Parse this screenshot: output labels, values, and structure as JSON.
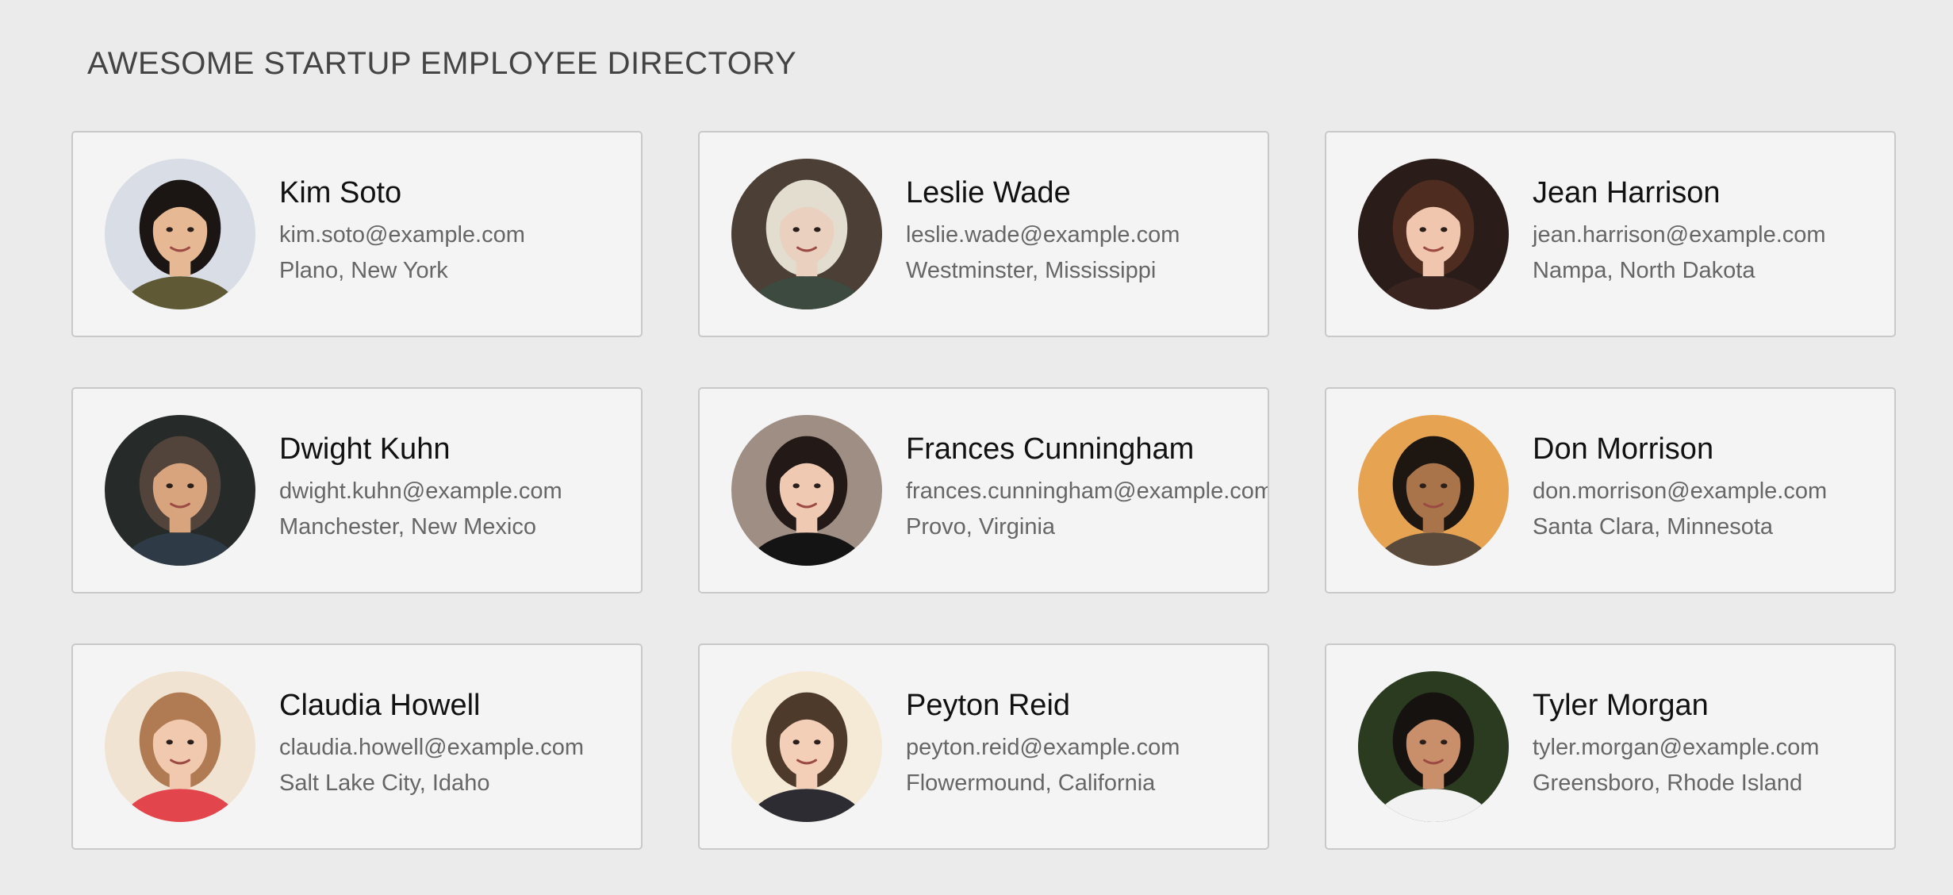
{
  "header": {
    "title": "AWESOME STARTUP EMPLOYEE DIRECTORY"
  },
  "employees": [
    {
      "name": "Kim Soto",
      "email": "kim.soto@example.com",
      "location": "Plano, New York",
      "avatar": {
        "bg": "#d8dde6",
        "hair": "#1b1613",
        "skin": "#e6b894",
        "shirt": "#5f5a35"
      }
    },
    {
      "name": "Leslie Wade",
      "email": "leslie.wade@example.com",
      "location": "Westminster, Mississippi",
      "avatar": {
        "bg": "#4b3f36",
        "hair": "#e3ddd0",
        "skin": "#ead0bf",
        "shirt": "#3d4a40"
      }
    },
    {
      "name": "Jean Harrison",
      "email": "jean.harrison@example.com",
      "location": "Nampa, North Dakota",
      "avatar": {
        "bg": "#2a1c18",
        "hair": "#4e2c20",
        "skin": "#f0c6ae",
        "shirt": "#3a2420"
      }
    },
    {
      "name": "Dwight Kuhn",
      "email": "dwight.kuhn@example.com",
      "location": "Manchester, New Mexico",
      "avatar": {
        "bg": "#262a28",
        "hair": "#52443a",
        "skin": "#d8a47e",
        "shirt": "#2e3b46"
      }
    },
    {
      "name": "Frances Cunningham",
      "email": "frances.cunningham@example.com",
      "location": "Provo, Virginia",
      "avatar": {
        "bg": "#9f8e83",
        "hair": "#231916",
        "skin": "#efc9b2",
        "shirt": "#141414"
      }
    },
    {
      "name": "Don Morrison",
      "email": "don.morrison@example.com",
      "location": "Santa Clara, Minnesota",
      "avatar": {
        "bg": "#e6a452",
        "hair": "#1d1611",
        "skin": "#a97449",
        "shirt": "#5a4a3c"
      }
    },
    {
      "name": "Claudia Howell",
      "email": "claudia.howell@example.com",
      "location": "Salt Lake City, Idaho",
      "avatar": {
        "bg": "#f1e3d2",
        "hair": "#b07b52",
        "skin": "#f0c9ae",
        "shirt": "#e2464c"
      }
    },
    {
      "name": "Peyton Reid",
      "email": "peyton.reid@example.com",
      "location": "Flowermound, California",
      "avatar": {
        "bg": "#f4ead6",
        "hair": "#4e3a2b",
        "skin": "#f4cfb8",
        "shirt": "#2c2c32"
      }
    },
    {
      "name": "Tyler Morgan",
      "email": "tyler.morgan@example.com",
      "location": "Greensboro, Rhode Island",
      "avatar": {
        "bg": "#2a3b1f",
        "hair": "#161210",
        "skin": "#c98f6b",
        "shirt": "#f2f2f2"
      }
    }
  ]
}
